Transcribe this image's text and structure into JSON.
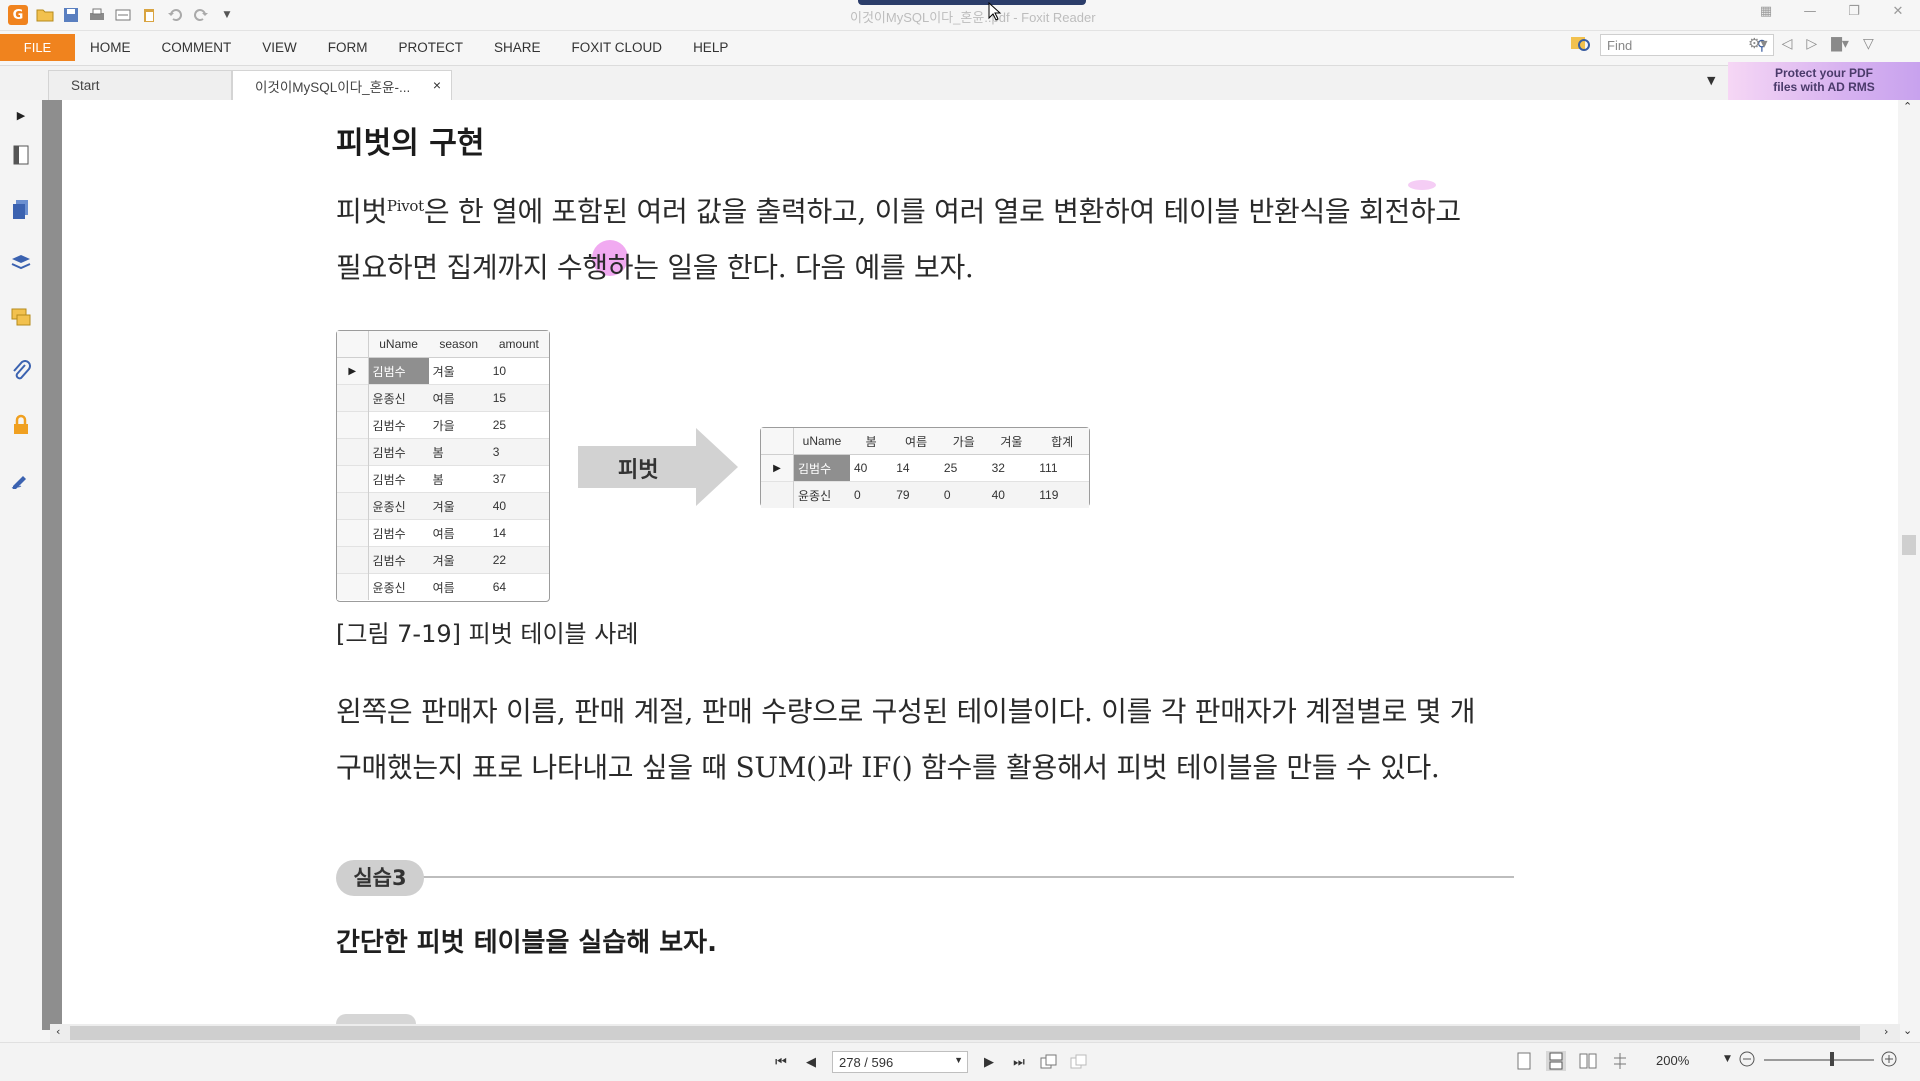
{
  "window": {
    "title": "이것이MySQL이다_혼윤..pdf - Foxit Reader"
  },
  "menu": {
    "file": "FILE",
    "items": [
      "HOME",
      "COMMENT",
      "VIEW",
      "FORM",
      "PROTECT",
      "SHARE",
      "FOXIT CLOUD",
      "HELP"
    ]
  },
  "search": {
    "placeholder": "Find"
  },
  "tabs": [
    {
      "label": "Start"
    },
    {
      "label": "이것이MySQL이다_혼윤-...",
      "close": "×"
    }
  ],
  "ad": {
    "line1": "Protect your PDF",
    "line2": "files with AD RMS"
  },
  "document": {
    "heading": "피벗의 구현",
    "para1_a": "피벗",
    "para1_sup": "Pivot",
    "para1_b": "은 한 열에 포함된 여러 값을 출력하고, 이를 여러 열로 변환하여 테이블 반환식을 회전하고",
    "para1_line2": "필요하면 집계까지 수행하는 일을 한다. 다음 예를 보자.",
    "arrow_label": "피벗",
    "caption": "[그림 7-19] 피벗 테이블 사례",
    "para2_line1": "왼쪽은 판매자 이름, 판매 계절, 판매 수량으로 구성된 테이블이다. 이를 각 판매자가 계절별로 몇 개",
    "para2_line2": "구매했는지 표로 나타내고 싶을 때 SUM()과 IF() 함수를 활용해서 피벗 테이블을 만들 수 있다.",
    "practice_badge": "실습3",
    "practice_title": "간단한 피벗 테이블을 실습해 보자."
  },
  "source_table": {
    "columns": [
      "uName",
      "season",
      "amount"
    ],
    "rows": [
      [
        "김범수",
        "겨울",
        "10"
      ],
      [
        "윤종신",
        "여름",
        "15"
      ],
      [
        "김범수",
        "가을",
        "25"
      ],
      [
        "김범수",
        "봄",
        "3"
      ],
      [
        "김범수",
        "봄",
        "37"
      ],
      [
        "윤종신",
        "겨울",
        "40"
      ],
      [
        "김범수",
        "여름",
        "14"
      ],
      [
        "김범수",
        "겨울",
        "22"
      ],
      [
        "윤종신",
        "여름",
        "64"
      ]
    ]
  },
  "pivot_table": {
    "columns": [
      "uName",
      "봄",
      "여름",
      "가을",
      "겨울",
      "합계"
    ],
    "rows": [
      [
        "김범수",
        "40",
        "14",
        "25",
        "32",
        "111"
      ],
      [
        "윤종신",
        "0",
        "79",
        "0",
        "40",
        "119"
      ]
    ]
  },
  "statusbar": {
    "page": "278 / 596",
    "zoom": "200%"
  },
  "colors": {
    "accent": "#f0831e",
    "selected_cell": "#8f8f8f"
  }
}
